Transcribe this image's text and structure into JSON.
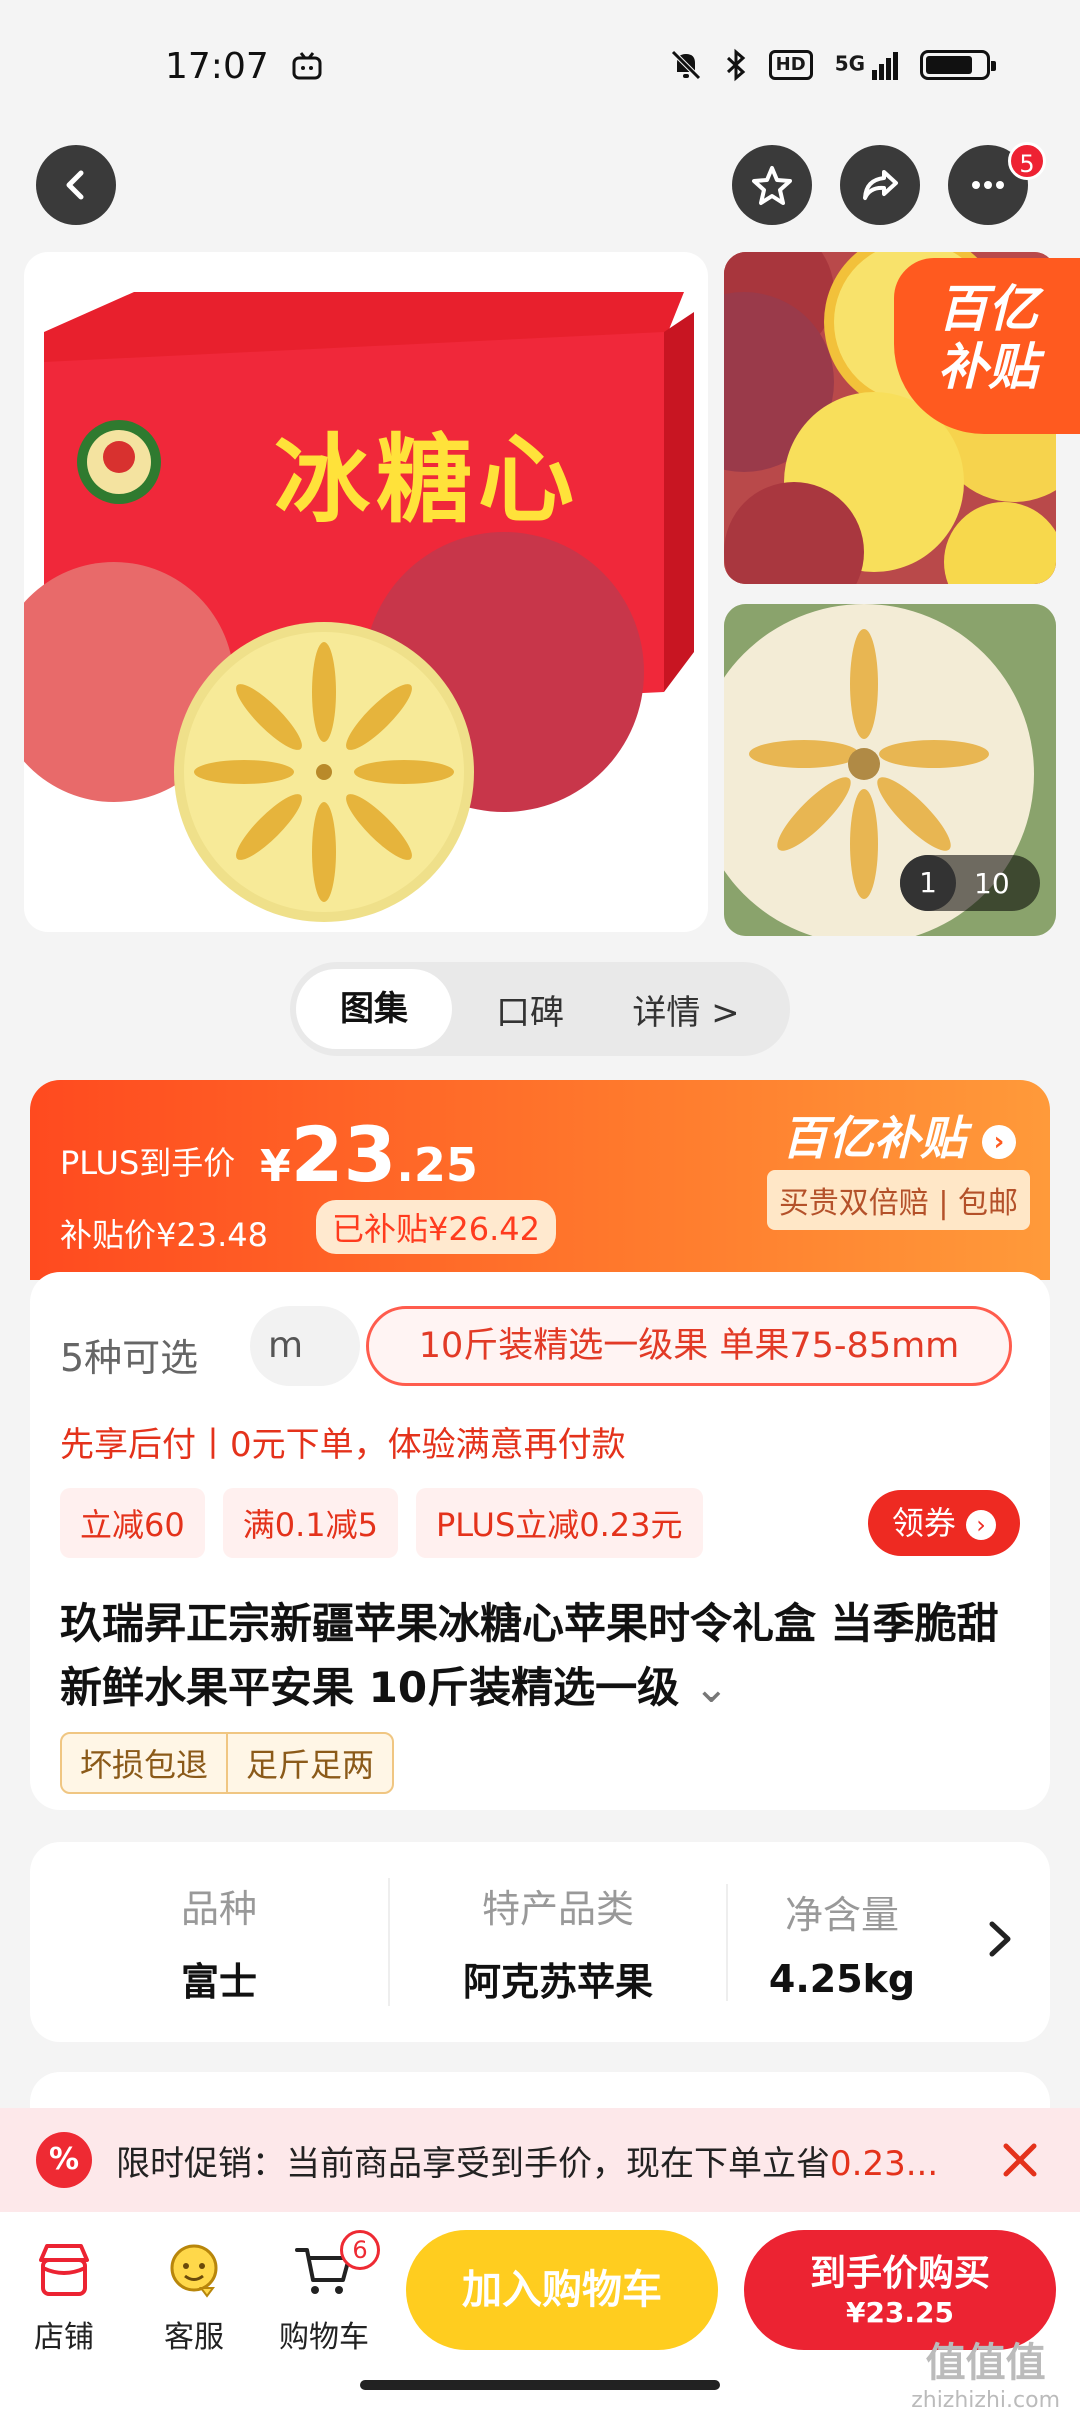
{
  "status": {
    "time": "17:07",
    "network": "5G",
    "hd": "HD"
  },
  "nav": {
    "more_badge": "5"
  },
  "gallery": {
    "main_box_text": "冰糖心",
    "side_tag": "百亿补贴",
    "counter_current": "1",
    "counter_total": "10"
  },
  "segments": {
    "tabs": [
      "图集",
      "口碑",
      "详情 >"
    ]
  },
  "price": {
    "label": "PLUS到手价",
    "currency": "¥",
    "amount_int": "23",
    "amount_dec": ".25",
    "subsidy_price": "补贴价¥23.48",
    "subsidized": "已补贴¥26.42",
    "brand": "百亿补贴",
    "guarantee": "买贵双倍赔 | 包邮"
  },
  "product": {
    "option_count": "5种可选",
    "option_partial": "m",
    "option_selected": "10斤装精选一级果 单果75-85mm",
    "bnpl": "先享后付丨0元下单，体验满意再付款",
    "coupons": [
      "立减60",
      "满0.1减5",
      "PLUS立减0.23元"
    ],
    "get_coupon": "领券",
    "title": "玖瑞昇正宗新疆苹果冰糖心苹果时令礼盒 当季脆甜新鲜水果平安果 10斤装精选一级",
    "tags": [
      "坏损包退",
      "足斤足两"
    ]
  },
  "specs": [
    {
      "key": "品种",
      "value": "富士"
    },
    {
      "key": "特产品类",
      "value": "阿克苏苹果"
    },
    {
      "key": "净含量",
      "value": "4.25kg"
    }
  ],
  "promo": {
    "icon": "%",
    "text": "限时促销：当前商品享受到手价，现在下单立省",
    "highlight": "0.23..."
  },
  "bottom": {
    "store": "店铺",
    "service": "客服",
    "cart": "购物车",
    "cart_count": "6",
    "add_to_cart": "加入购物车",
    "buy_label": "到手价购买",
    "buy_price": "¥23.25"
  },
  "watermark": {
    "line1": "值值值",
    "line2": "zhizhizhi.com"
  }
}
